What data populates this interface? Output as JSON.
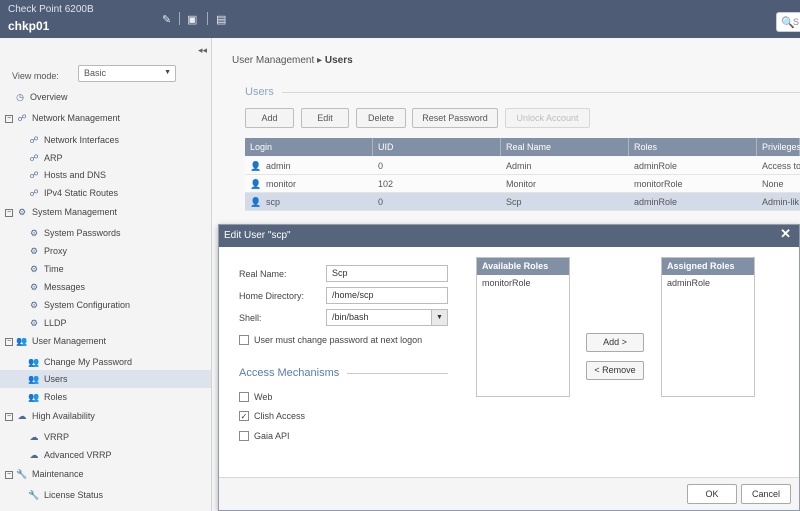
{
  "header": {
    "product": "Check Point 6200B",
    "host": "chkp01",
    "search_placeholder": "S"
  },
  "sidebar": {
    "view_mode_label": "View mode:",
    "view_mode_value": "Basic",
    "items": {
      "overview": "Overview",
      "network_management": "Network Management",
      "network_interfaces": "Network Interfaces",
      "arp": "ARP",
      "hosts_dns": "Hosts and DNS",
      "ipv4_static_routes": "IPv4 Static Routes",
      "system_management": "System Management",
      "system_passwords": "System Passwords",
      "proxy": "Proxy",
      "time": "Time",
      "messages": "Messages",
      "system_configuration": "System Configuration",
      "lldp": "LLDP",
      "user_management": "User Management",
      "change_my_password": "Change My Password",
      "users": "Users",
      "roles": "Roles",
      "high_availability": "High Availability",
      "vrrp": "VRRP",
      "advanced_vrrp": "Advanced VRRP",
      "maintenance": "Maintenance",
      "license_status": "License Status"
    }
  },
  "breadcrumb": {
    "parent": "User Management",
    "current": "Users"
  },
  "users_section": {
    "title": "Users",
    "buttons": {
      "add": "Add",
      "edit": "Edit",
      "delete": "Delete",
      "reset_password": "Reset Password",
      "unlock_account": "Unlock Account"
    },
    "columns": [
      "Login",
      "UID",
      "Real Name",
      "Roles",
      "Privileges"
    ],
    "rows": [
      {
        "login": "admin",
        "uid": "0",
        "real_name": "Admin",
        "roles": "adminRole",
        "privileges": "Access to"
      },
      {
        "login": "monitor",
        "uid": "102",
        "real_name": "Monitor",
        "roles": "monitorRole",
        "privileges": "None"
      },
      {
        "login": "scp",
        "uid": "0",
        "real_name": "Scp",
        "roles": "adminRole",
        "privileges": "Admin-lik"
      }
    ]
  },
  "dialog": {
    "title": "Edit User \"scp\"",
    "real_name_label": "Real Name:",
    "real_name_value": "Scp",
    "home_dir_label": "Home Directory:",
    "home_dir_value": "/home/scp",
    "shell_label": "Shell:",
    "shell_value": "/bin/bash",
    "must_change_label": "User must change password at next logon",
    "access_title": "Access Mechanisms",
    "access": {
      "web": "Web",
      "clish": "Clish Access",
      "gaia_api": "Gaia API"
    },
    "available_roles_title": "Available Roles",
    "available_roles": [
      "monitorRole"
    ],
    "assigned_roles_title": "Assigned Roles",
    "assigned_roles": [
      "adminRole"
    ],
    "add_button": "Add >",
    "remove_button": "< Remove",
    "ok_button": "OK",
    "cancel_button": "Cancel"
  }
}
